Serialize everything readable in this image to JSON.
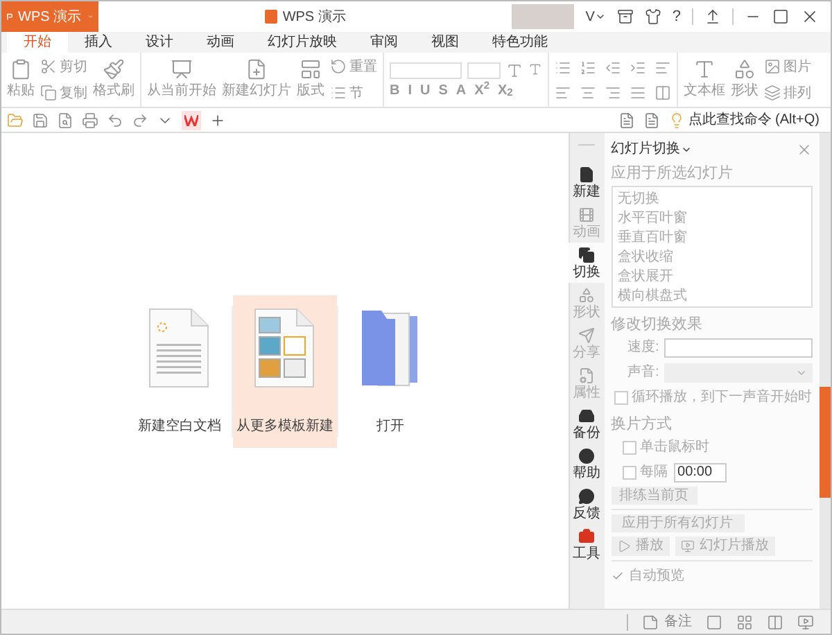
{
  "app_menu": {
    "label": "WPS 演示"
  },
  "window": {
    "title": "WPS 演示"
  },
  "account": {
    "label": "V",
    "help": "?"
  },
  "tabs": [
    {
      "label": "开始",
      "selected": true
    },
    {
      "label": "插入",
      "selected": false
    },
    {
      "label": "设计",
      "selected": false
    },
    {
      "label": "动画",
      "selected": false
    },
    {
      "label": "幻灯片放映",
      "selected": false
    },
    {
      "label": "审阅",
      "selected": false
    },
    {
      "label": "视图",
      "selected": false
    },
    {
      "label": "特色功能",
      "selected": false
    }
  ],
  "ribbon": {
    "paste": "粘贴",
    "cut": "剪切",
    "copy": "复制",
    "format_painter": "格式刷",
    "from_current": "从当前开始",
    "new_slide": "新建幻灯片",
    "layout": "版式",
    "reset": "重置",
    "section": "节",
    "format_buttons": [
      "B",
      "I",
      "U",
      "S",
      "A",
      "X$^{2}$",
      "X$_{2}$"
    ],
    "text_box": "文本框",
    "shape": "形状",
    "picture": "图片",
    "arrange": "排列"
  },
  "command_search": {
    "placeholder": "点此查找命令 (Alt+Q)"
  },
  "start_page": [
    {
      "kind": "blank",
      "label": "新建空白文档",
      "selected": false
    },
    {
      "kind": "template",
      "label": "从更多模板新建",
      "selected": true
    },
    {
      "kind": "open",
      "label": "打开",
      "selected": false
    }
  ],
  "side_tabs": [
    {
      "label": "新建",
      "selected": false,
      "disabled": false
    },
    {
      "label": "动画",
      "selected": false,
      "disabled": true
    },
    {
      "label": "切换",
      "selected": true,
      "disabled": false
    },
    {
      "label": "形状",
      "selected": false,
      "disabled": true
    },
    {
      "label": "分享",
      "selected": false,
      "disabled": true
    },
    {
      "label": "属性",
      "selected": false,
      "disabled": true
    },
    {
      "label": "备份",
      "selected": false,
      "disabled": false
    },
    {
      "label": "帮助",
      "selected": false,
      "disabled": false
    },
    {
      "label": "反馈",
      "selected": false,
      "disabled": false
    },
    {
      "label": "工具",
      "selected": false,
      "disabled": false
    }
  ],
  "panel": {
    "title": "幻灯片切换",
    "apply_heading": "应用于所选幻灯片",
    "transitions": [
      "无切换",
      "水平百叶窗",
      "垂直百叶窗",
      "盒状收缩",
      "盒状展开",
      "横向棋盘式"
    ],
    "modify_heading": "修改切换效果",
    "speed_label": "速度:",
    "sound_label": "声音:",
    "loop": {
      "label": "循环播放，到下一声音开始时",
      "checked": false
    },
    "advance_heading": "换片方式",
    "on_click": {
      "label": "单击鼠标时",
      "checked": false
    },
    "every": {
      "label": "每隔",
      "checked": false,
      "value": "00:00"
    },
    "rehearse": "排练当前页",
    "apply_all": "应用于所有幻灯片",
    "play": "播放",
    "slideshow": "幻灯片播放",
    "auto_preview": {
      "label": "自动预览",
      "checked": true
    }
  },
  "status_bar": {
    "notes": "备注"
  }
}
